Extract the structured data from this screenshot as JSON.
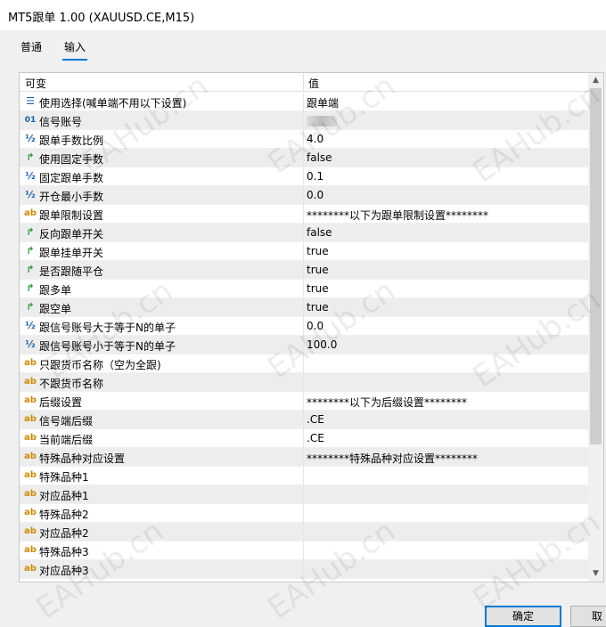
{
  "window": {
    "title": "MT5跟单 1.00 (XAUUSD.CE,M15)"
  },
  "tabs": [
    {
      "label": "普通"
    },
    {
      "label": "输入"
    }
  ],
  "grid": {
    "col_variable": "可变",
    "col_value": "值",
    "rows": [
      {
        "icon": "list-icon",
        "name": "使用选择(喊单端不用以下设置)",
        "value": "跟单端"
      },
      {
        "icon": "int-icon",
        "name": "信号账号",
        "value": ""
      },
      {
        "icon": "double-icon",
        "name": "跟单手数比例",
        "value": "4.0"
      },
      {
        "icon": "bool-icon",
        "name": "使用固定手数",
        "value": "false"
      },
      {
        "icon": "double-icon",
        "name": "固定跟单手数",
        "value": "0.1"
      },
      {
        "icon": "double-icon",
        "name": "开仓最小手数",
        "value": "0.0"
      },
      {
        "icon": "string-icon",
        "name": "跟单限制设置",
        "value": "********以下为跟单限制设置********"
      },
      {
        "icon": "bool-icon",
        "name": "反向跟单开关",
        "value": "false"
      },
      {
        "icon": "bool-icon",
        "name": "跟单挂单开关",
        "value": "true"
      },
      {
        "icon": "bool-icon",
        "name": "是否跟随平仓",
        "value": "true"
      },
      {
        "icon": "bool-icon",
        "name": "跟多单",
        "value": "true"
      },
      {
        "icon": "bool-icon",
        "name": "跟空单",
        "value": "true"
      },
      {
        "icon": "double-icon",
        "name": "跟信号账号大于等于N的单子",
        "value": "0.0"
      },
      {
        "icon": "double-icon",
        "name": "跟信号账号小于等于N的单子",
        "value": "100.0"
      },
      {
        "icon": "string-icon",
        "name": "只跟货币名称（空为全跟)",
        "value": ""
      },
      {
        "icon": "string-icon",
        "name": "不跟货币名称",
        "value": ""
      },
      {
        "icon": "string-icon",
        "name": "后缀设置",
        "value": "********以下为后缀设置********"
      },
      {
        "icon": "string-icon",
        "name": "信号端后缀",
        "value": ".CE"
      },
      {
        "icon": "string-icon",
        "name": "当前端后缀",
        "value": ".CE"
      },
      {
        "icon": "string-icon",
        "name": "特殊品种对应设置",
        "value": "********特殊品种对应设置********"
      },
      {
        "icon": "string-icon",
        "name": "特殊品种1",
        "value": ""
      },
      {
        "icon": "string-icon",
        "name": "对应品种1",
        "value": ""
      },
      {
        "icon": "string-icon",
        "name": "特殊品种2",
        "value": ""
      },
      {
        "icon": "string-icon",
        "name": "对应品种2",
        "value": ""
      },
      {
        "icon": "string-icon",
        "name": "特殊品种3",
        "value": ""
      },
      {
        "icon": "string-icon",
        "name": "对应品种3",
        "value": ""
      }
    ]
  },
  "buttons": {
    "ok": "确定",
    "cancel": "取"
  },
  "watermark": "EAHub.cn",
  "icon_glyphs": {
    "list-icon": "☰",
    "int-icon": "01",
    "double-icon": "½",
    "bool-icon": "↱",
    "string-icon": "ab"
  }
}
